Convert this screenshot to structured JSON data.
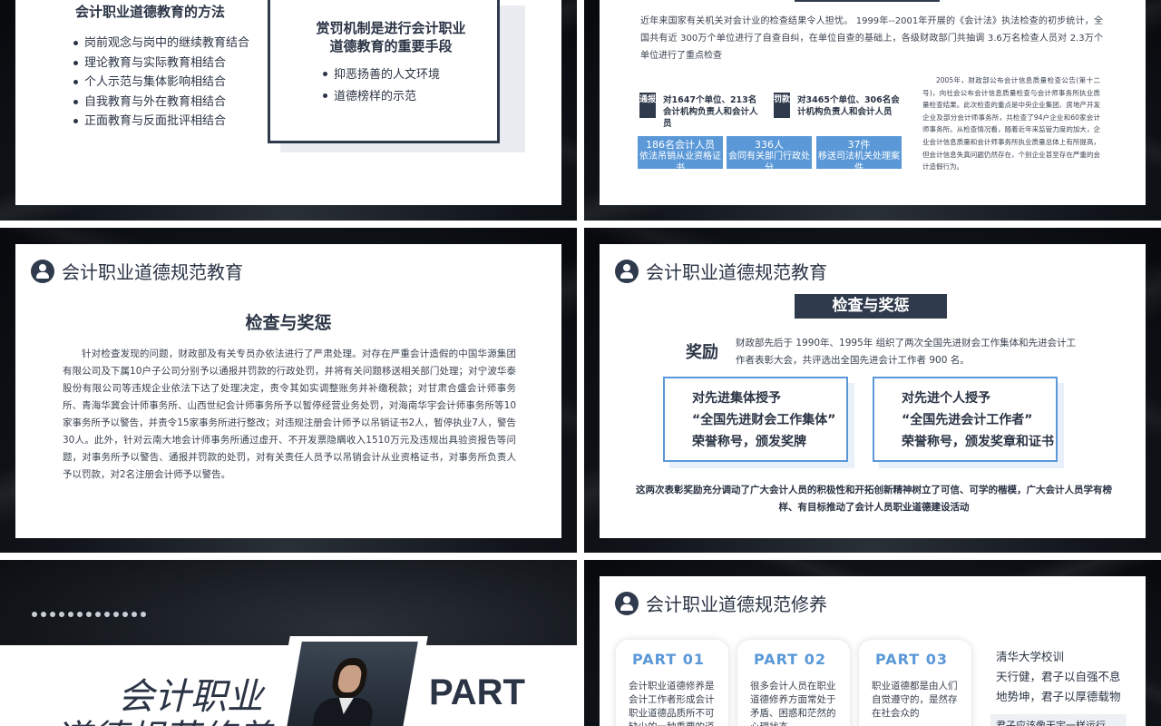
{
  "slide1": {
    "left_title": "会计职业道德教育的方法",
    "left_items": [
      "岗前观念与岗中的继续教育结合",
      "理论教育与实际教育相结合",
      "个人示范与集体影响相结合",
      "自我教育与外在教育相结合",
      "正面教育与反面批评相结合"
    ],
    "box_title": "赏罚机制是进行会计职业道德教育的重要手段",
    "box_items": [
      "抑恶扬善的人文环境",
      "道德榜样的示范"
    ]
  },
  "slide2": {
    "intro": "近年来国家有关机关对会计业的检查结果令人担忧。 1999年--2001年开展的《会计法》执法检查的初步统计，全国共有近 300万个单位进行了自查自纠，在单位自查的基础上，各级财政部门共抽调 3.6万名检查人员对 2.3万个单位进行了重点检查",
    "notice_badge": "通报",
    "notice_text": "对1647个单位、213名会计机构负责人和会计人员",
    "fine_badge": "罚款",
    "fine_text": "对3465个单位、306名会计机构负责人和会计人员",
    "stats": [
      {
        "value": "186名会计人员",
        "label": "依法吊销从业资格证书"
      },
      {
        "value": "336人",
        "label": "会同有关部门行政处分"
      },
      {
        "value": "37件",
        "label": "移送司法机关处理案件"
      }
    ],
    "side_text": "2005年，财政部公布会计信息质量检查公告(第十二号)，向社会公布会计信息质量检查与会计师事务所执业质量检查结果。此次检查的重点是中央企业集团、房地产开发企业及部分会计师事务所，共检查了94户企业和60家会计师事务所。从检查情况看，随着近年来监管力度的加大，企业会计信息质量和会计师事务所执业质量总体上有所提高，但会计信息失真问题仍然存在，个别企业甚至存在严重的会计造假行为。"
  },
  "slide3": {
    "header": "会计职业道德规范教育",
    "subtitle": "检查与奖惩",
    "body": "针对检查发现的问题，财政部及有关专员办依法进行了严肃处理。对存在严重会计造假的中国华源集团有限公司及下属10户子公司分别予以通报并罚款的行政处罚，并将有关问题移送相关部门处理；对宁波华泰股份有限公司等违规企业依法下达了处理决定，责令其如实调整账务并补缴税款；对甘肃合盛会计师事务所、青海华冀会计师事务所、山西世纪会计师事务所予以暂停经营业务处罚，对海南华宇会计师事务所等10家事务所予以警告，并责令15家事务所进行整改；对违规注册会计师予以吊销证书2人，暂停执业7人，警告30人。此外，针对云南大地会计师事务所通过虚开、不开发票隐瞒收入1510万元及违规出具验资报告等问题，对事务所予以警告、通报并罚款的处罚，对有关责任人员予以吊销会计从业资格证书，对事务所负责人予以罚款，对2名注册会计师予以警告。"
  },
  "slide4": {
    "header": "会计职业道德规范教育",
    "banner": "检查与奖惩",
    "reward_label": "奖励",
    "reward_text": "财政部先后于 1990年、1995年 组织了两次全国先进财会工作集体和先进会计工作者表彰大会，共评选出全国先进会计工作者 900 名。",
    "award_left": [
      "对先进集体授予",
      "“全国先进财会工作集体”",
      "荣誉称号，颁发奖牌"
    ],
    "award_right": [
      "对先进个人授予",
      "“全国先进会计工作者”",
      "荣誉称号，颁发奖章和证书"
    ],
    "summary": "这两次表彰奖励充分调动了广大会计人员的积极性和开拓创新精神树立了可信、可学的楷模，广大会计人员学有榜样、有目标推动了会计人员职业道德建设活动"
  },
  "slide5": {
    "title_line1": "会计职业",
    "title_line2": "道德规范修养",
    "part_word": "PART"
  },
  "slide6": {
    "header": "会计职业道德规范修养",
    "parts": [
      {
        "title": "PART 01",
        "text": "会计职业道德修养是会计工作者形成会计职业道德品质所不可缺少的一种重要的道"
      },
      {
        "title": "PART 02",
        "text": "很多会计人员在职业道德修养方面常处于矛盾、困惑和茫然的心理状态。"
      },
      {
        "title": "PART 03",
        "text": "职业道德都是由人们自觉遵守的，是然存在社会众的"
      }
    ],
    "motto_title": "清华大学校训",
    "motto_lines": [
      "天行健，君子以自强不息",
      "地势坤，君子以厚德载物"
    ],
    "motto_tail": "君子应该像天宇一样运行"
  },
  "colors": {
    "accent": "#5a98d8",
    "dark": "#2f3a4c",
    "text": "#2b3445"
  }
}
